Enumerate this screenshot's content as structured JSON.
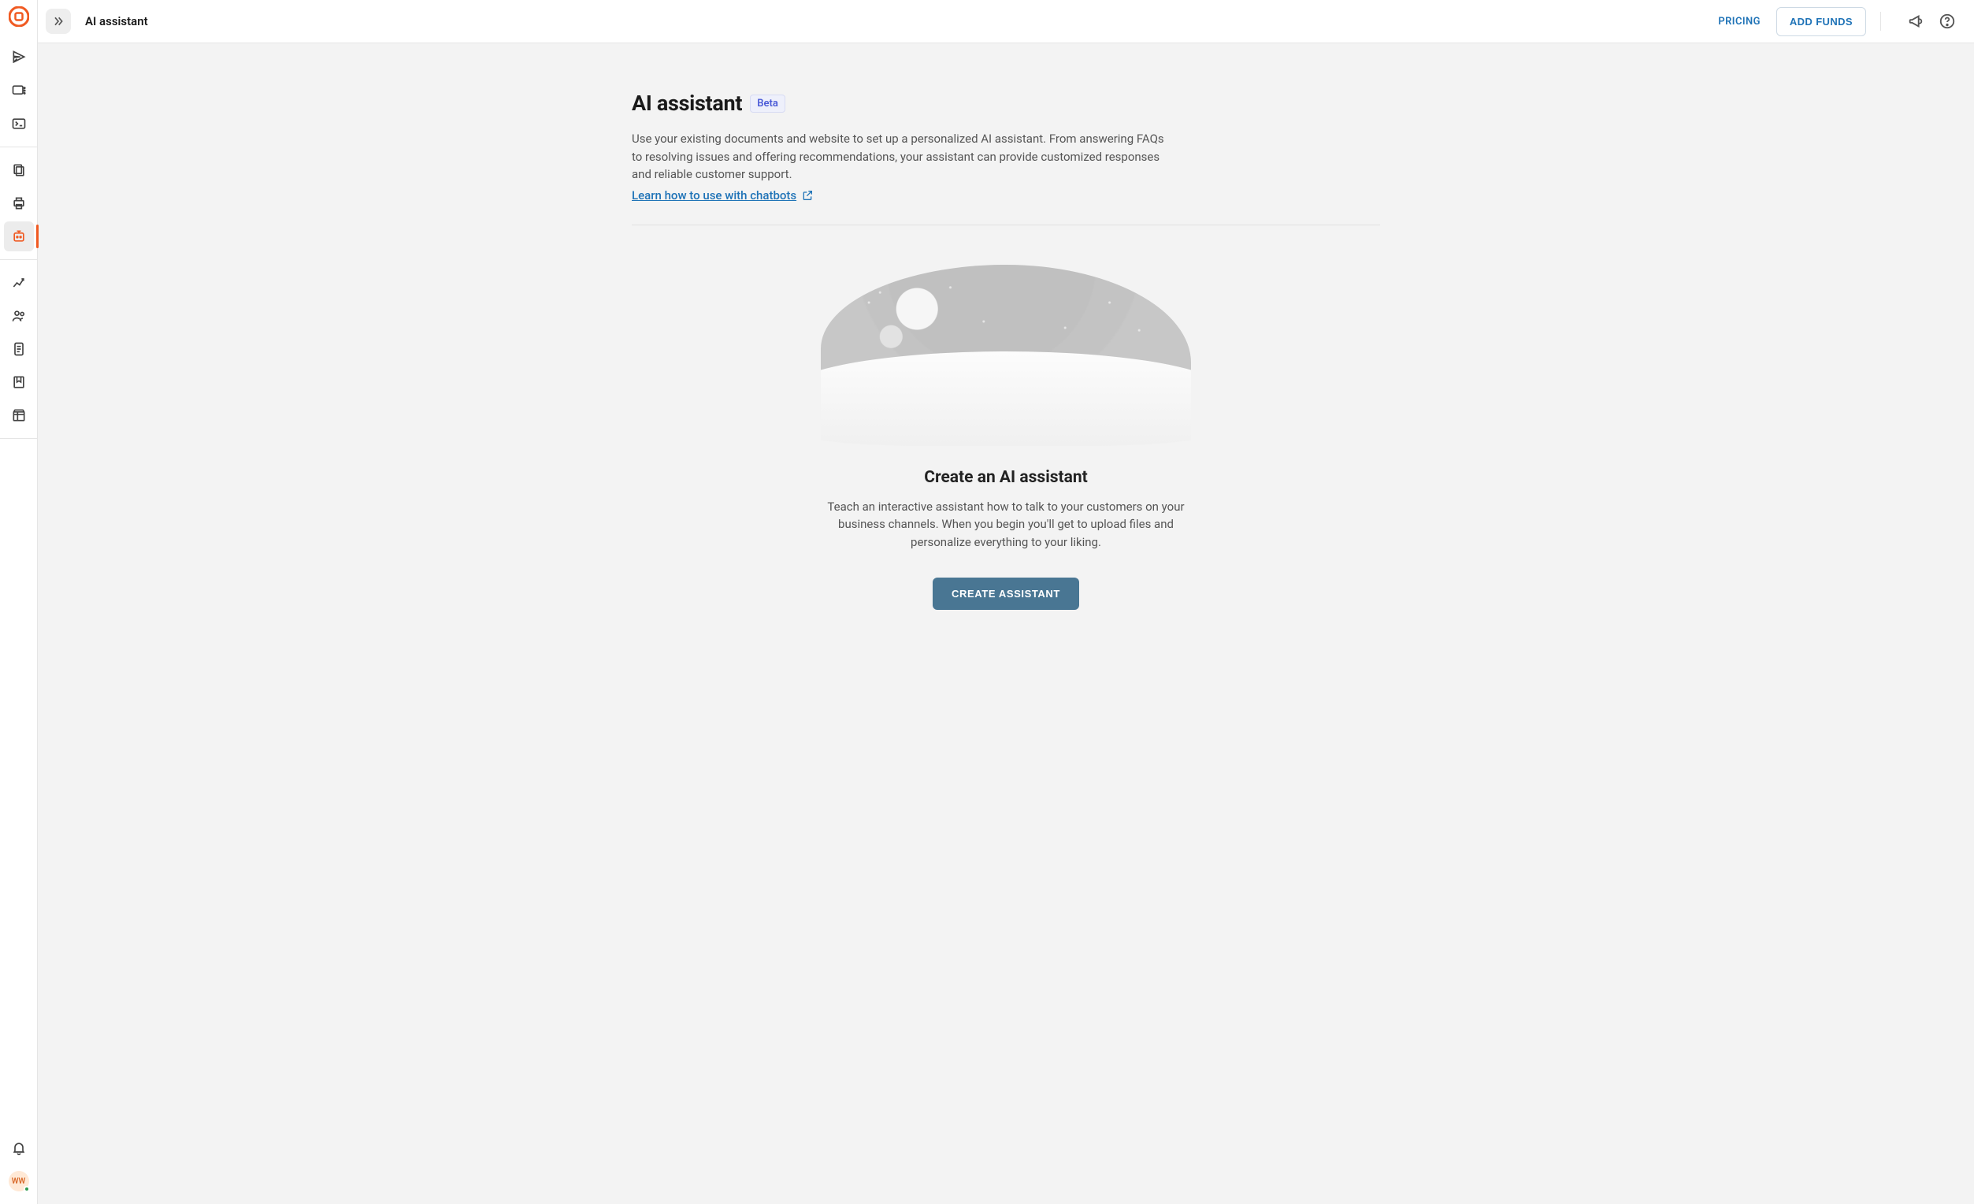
{
  "header": {
    "title": "AI assistant",
    "pricing_label": "PRICING",
    "add_funds_label": "ADD FUNDS"
  },
  "sidebar": {
    "avatar_initials": "WW"
  },
  "page": {
    "title": "AI assistant",
    "badge": "Beta",
    "description": "Use your existing documents and website to set up a personalized AI assistant. From answering FAQs to resolving issues and offering recommendations, your assistant can provide customized responses and reliable customer support.",
    "learn_link": "Learn how to use with chatbots"
  },
  "empty": {
    "title": "Create an AI assistant",
    "description": "Teach an interactive assistant how to talk to your customers on your business channels. When you begin you'll get to upload files and personalize everything to your liking.",
    "button_label": "CREATE ASSISTANT"
  }
}
